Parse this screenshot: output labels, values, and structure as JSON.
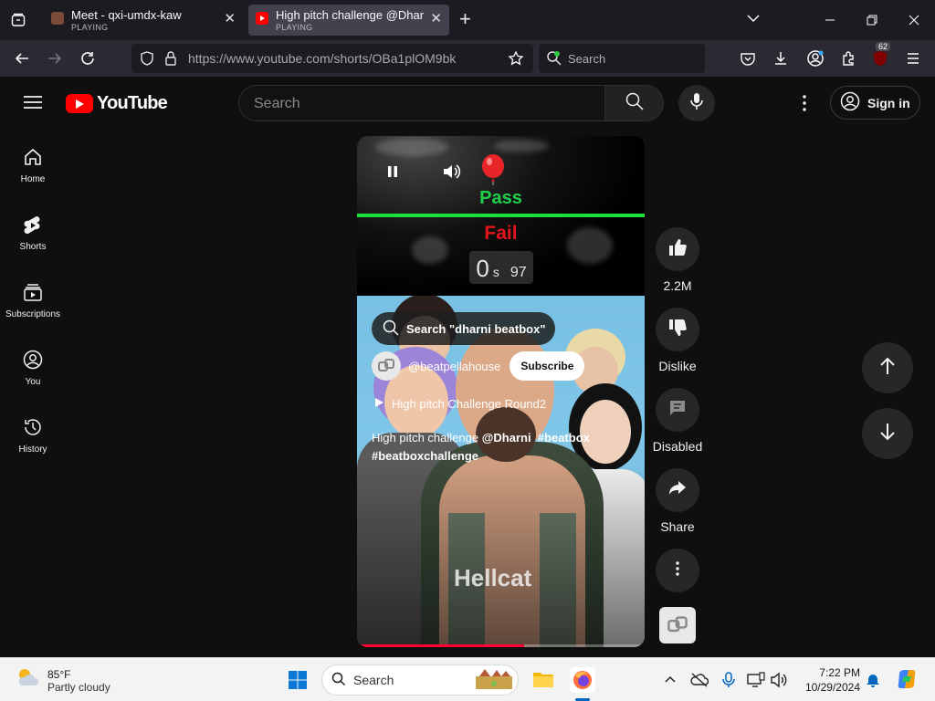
{
  "browser": {
    "tabs": [
      {
        "title": "Meet - qxi-umdx-kaw",
        "status": "PLAYING",
        "active": false
      },
      {
        "title": "High pitch challenge @Dharni #",
        "status": "PLAYING",
        "active": true
      }
    ],
    "url": "https://www.youtube.com/shorts/OBa1plOM9bk",
    "search_placeholder": "Search",
    "extensions_badge": "62"
  },
  "youtube": {
    "logo_text": "YouTube",
    "search_placeholder": "Search",
    "signin_label": "Sign in",
    "sidebar": [
      {
        "label": "Home",
        "icon": "home-icon"
      },
      {
        "label": "Shorts",
        "icon": "shorts-icon"
      },
      {
        "label": "Subscriptions",
        "icon": "subscriptions-icon"
      },
      {
        "label": "You",
        "icon": "you-icon"
      },
      {
        "label": "History",
        "icon": "history-icon"
      }
    ],
    "short": {
      "pass_label": "Pass",
      "fail_label": "Fail",
      "timer_value": "0",
      "timer_unit": "s",
      "timer_count": "97",
      "overlay_search": "Search \"dharni beatbox\"",
      "channel": "@beatpellahouse",
      "subscribe_label": "Subscribe",
      "song": "High pitch Challenge Round2",
      "video_text": "Hellcat",
      "description_plain": "High pitch challenge ",
      "description_tags": [
        "@Dharni",
        "#beatbox",
        "#beatboxchallenge"
      ],
      "progress_fraction": 0.58
    },
    "actions": {
      "like_count": "2.2M",
      "dislike_label": "Dislike",
      "comments_label": "Disabled",
      "share_label": "Share"
    }
  },
  "taskbar": {
    "temperature": "85°F",
    "condition": "Partly cloudy",
    "search_placeholder": "Search",
    "time": "7:22 PM",
    "date": "10/29/2024"
  },
  "colors": {
    "yt_red": "#ff0000",
    "pass_green": "#21d04a",
    "fail_red": "#e3141b",
    "browser_dark": "#1c1b22"
  }
}
